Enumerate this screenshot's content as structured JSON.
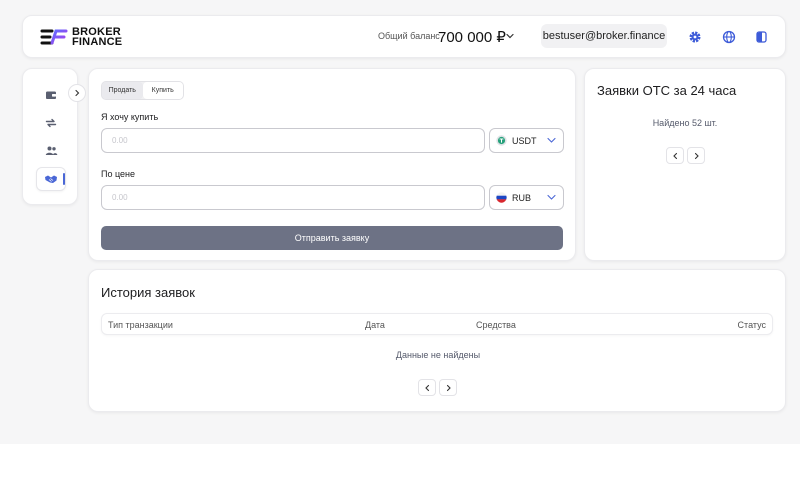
{
  "header": {
    "logo_line1": "BROKER",
    "logo_line2": "FINANCE",
    "balance_label": "Общий баланс",
    "balance_value": "700 000 ₽",
    "email": "bestuser@broker.finance",
    "icons": [
      "gear-icon",
      "globe-icon",
      "logout-icon"
    ]
  },
  "sidebar": {
    "items": [
      {
        "icon": "wallet-icon"
      },
      {
        "icon": "exchange-icon"
      },
      {
        "icon": "users-icon"
      },
      {
        "icon": "handshake-icon",
        "active": true
      }
    ],
    "expand_icon": "chevron-right-icon"
  },
  "form": {
    "tab_sell": "Продать",
    "tab_buy": "Купить",
    "buy_label": "Я хочу купить",
    "amount_placeholder": "0.00",
    "buy_currency": "USDT",
    "price_label": "По цене",
    "price_placeholder": "0.00",
    "price_currency": "RUB",
    "submit_label": "Отправить заявку"
  },
  "otc": {
    "title": "Заявки OTC за 24 часа",
    "found": "Найдено 52 шт."
  },
  "history": {
    "title": "История заявок",
    "columns": [
      "Тип транзакции",
      "Дата",
      "Средства",
      "Статус"
    ],
    "empty": "Данные не найдены"
  },
  "colors": {
    "accent": "#4a67d6",
    "button": "#6d7285",
    "usdt": "#26a17b",
    "logo_purple": "#7b3fe4"
  }
}
